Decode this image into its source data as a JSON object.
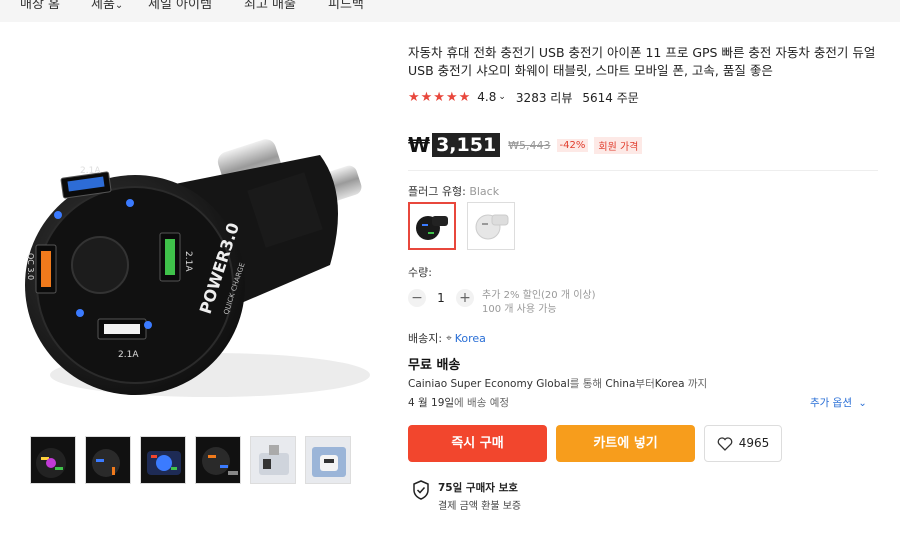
{
  "nav": {
    "items": [
      "매장 홈",
      "제품",
      "세일 아이템",
      "최고 매출",
      "피드백"
    ]
  },
  "product": {
    "title": "자동차 휴대 전화 충전기 USB 충전기 아이폰 11 프로 GPS 빠른 충전 자동차 충전기 듀얼 USB 충전기 샤오미 화웨이 태블릿, 스마트 모바일 폰, 고속, 품질 좋은",
    "rating": "4.8",
    "reviews": "3283 리뷰",
    "orders": "5614 주문",
    "stars_filled": 5,
    "charger_labels": {
      "port_a": "2.1A",
      "port_b": "2.1A",
      "port_c": "2.1A",
      "port_qc": "QC 3.0",
      "brand": "POWER3.0",
      "brand_sub": "QUICK CHARGE"
    }
  },
  "price": {
    "currency": "₩",
    "amount": "3,151",
    "original": "₩5,443",
    "discount": "-42%",
    "member_badge": "회원 가격"
  },
  "variant": {
    "label": "플러그 유형:",
    "selected": "Black"
  },
  "quantity": {
    "label": "수량:",
    "value": "1",
    "minus": "−",
    "plus": "+",
    "note1": "추가 2% 할인(20 개 이상)",
    "note2": "100 개 사용 가능"
  },
  "shipping": {
    "label": "배송지:",
    "location": "Korea",
    "title": "무료 배송",
    "desc_prefix": "Cainiao Super Economy Global",
    "desc_mid": "를 통해 ",
    "from": "China",
    "from_suffix": "부터",
    "to": "Korea",
    "to_suffix": " 까지",
    "date_strong": "4 월 19일",
    "date_suffix": "에 배송 예정",
    "more_options": "추가 옵션"
  },
  "actions": {
    "buy": "즉시 구매",
    "cart": "카트에 넣기",
    "wishlist_count": "4965"
  },
  "protection": {
    "title": "75일 구매자 보호",
    "desc": "결제 금액 환불 보증"
  },
  "colors": {
    "accent": "#f2462d",
    "cart": "#f79d1c",
    "star": "#e8473c",
    "link": "#2a6fd6"
  }
}
